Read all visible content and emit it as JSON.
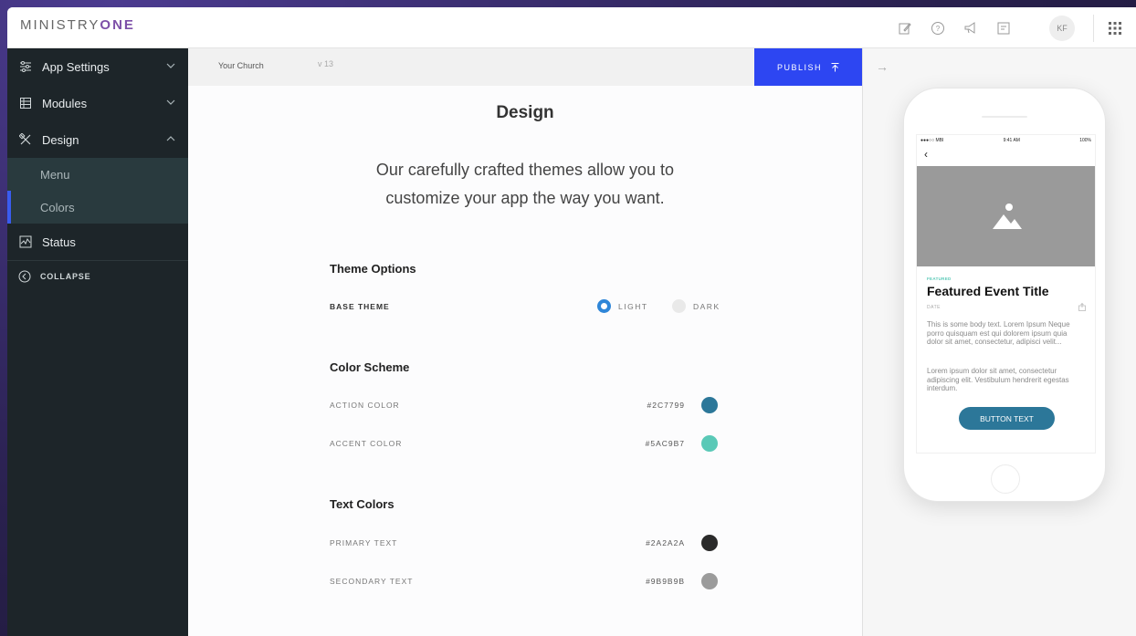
{
  "brand": {
    "name_part1": "MINISTRY",
    "name_part2": "ONE"
  },
  "topbar": {
    "avatar_initials": "KF"
  },
  "sidebar": {
    "items": [
      {
        "label": "App Settings"
      },
      {
        "label": "Modules"
      },
      {
        "label": "Design"
      },
      {
        "label": "Status"
      }
    ],
    "design_subitems": [
      {
        "label": "Menu"
      },
      {
        "label": "Colors"
      }
    ],
    "collapse_label": "COLLAPSE"
  },
  "subbar": {
    "church_name": "Your Church",
    "version": "v 13",
    "publish_label": "PUBLISH"
  },
  "main": {
    "title": "Design",
    "intro_line1": "Our carefully crafted themes allow you to",
    "intro_line2": "customize your app the way you want.",
    "theme_options": {
      "heading": "Theme Options",
      "base_theme_label": "BASE THEME",
      "options": [
        {
          "label": "LIGHT",
          "selected": true
        },
        {
          "label": "DARK",
          "selected": false
        }
      ]
    },
    "color_scheme": {
      "heading": "Color Scheme",
      "rows": [
        {
          "label": "ACTION COLOR",
          "hex": "#2C7799",
          "color": "#2c7799"
        },
        {
          "label": "ACCENT COLOR",
          "hex": "#5AC9B7",
          "color": "#5ac9b7"
        }
      ]
    },
    "text_colors": {
      "heading": "Text Colors",
      "rows": [
        {
          "label": "PRIMARY TEXT",
          "hex": "#2A2A2A",
          "color": "#2a2a2a"
        },
        {
          "label": "SECONDARY TEXT",
          "hex": "#9B9B9B",
          "color": "#9b9b9b"
        }
      ]
    }
  },
  "preview": {
    "arrow": "→",
    "status_left": "●●●○○ MBI ",
    "status_time": "9:41 AM",
    "status_right": "100%",
    "featured_label": "FEATURED",
    "event_title": "Featured Event Title",
    "date_label": "DATE",
    "body1": "This is some body text. Lorem Ipsum Neque porro quisquam est qui dolorem ipsum quia dolor sit amet, consectetur, adipisci velit...",
    "body2": "Lorem ipsum dolor sit amet, consectetur adipiscing elit. Vestibulum hendrerit egestas interdum.",
    "button_text": "BUTTON TEXT"
  },
  "colors": {
    "publish_bg": "#2d46f2",
    "sidebar_bg": "#1d2529",
    "active_indicator": "#3a5cf0",
    "logo_accent": "#7d4fa8"
  }
}
